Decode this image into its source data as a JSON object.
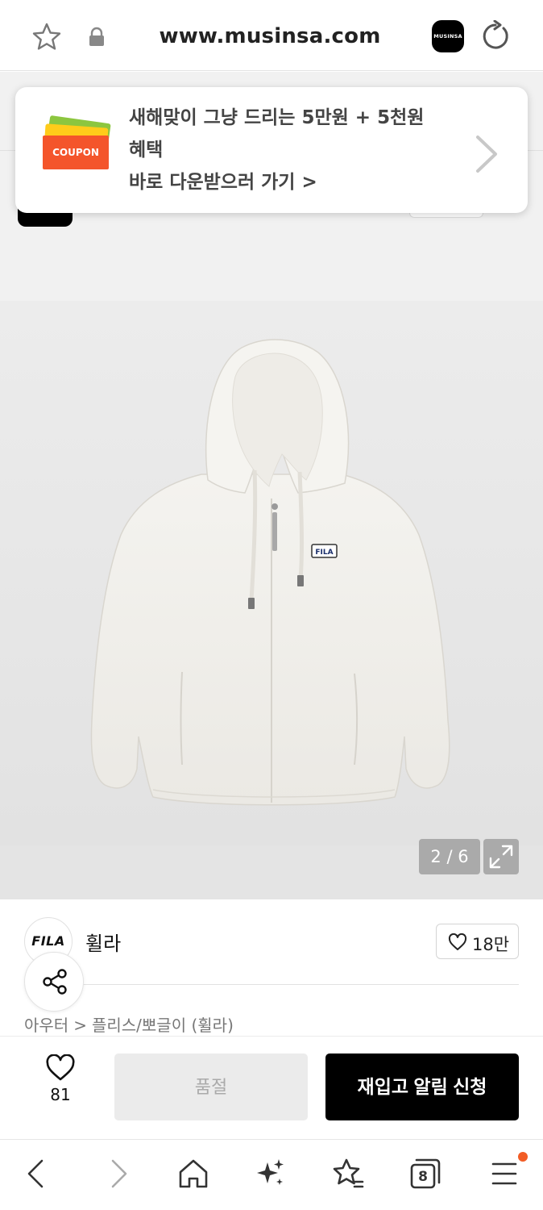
{
  "browser": {
    "url": "www.musinsa.com",
    "favicon_text": "MUSINSA",
    "icons": {
      "bookmark": "star-icon",
      "secure": "lock-icon",
      "reload": "reload-icon"
    }
  },
  "coupon_banner": {
    "badge": "COUPON",
    "line1": "새해맞이 그냥 드리는 5만원 + 5천원",
    "line2": "혜택",
    "cta": "바로 다운받으러 가기 >",
    "colors": {
      "ticket_green": "#8cc63f",
      "ticket_yellow": "#ffcc1a",
      "ticket_orange": "#f4552b"
    }
  },
  "gallery": {
    "counter": "2 / 6",
    "image_alt": "FILA white sherpa fleece hooded zip-up jacket"
  },
  "brand": {
    "logo_text": "FILA",
    "name": "휠라",
    "likes": "18만"
  },
  "breadcrumb": {
    "category": "아우터",
    "separator": ">",
    "subcategory": "플리스/뽀글이 (휠라)"
  },
  "actions": {
    "wish_count": "81",
    "soldout_label": "품절",
    "restock_label": "재입고 알림 신청"
  },
  "bottom_nav": {
    "tab_count": "8",
    "notification_color": "#f25c25"
  }
}
